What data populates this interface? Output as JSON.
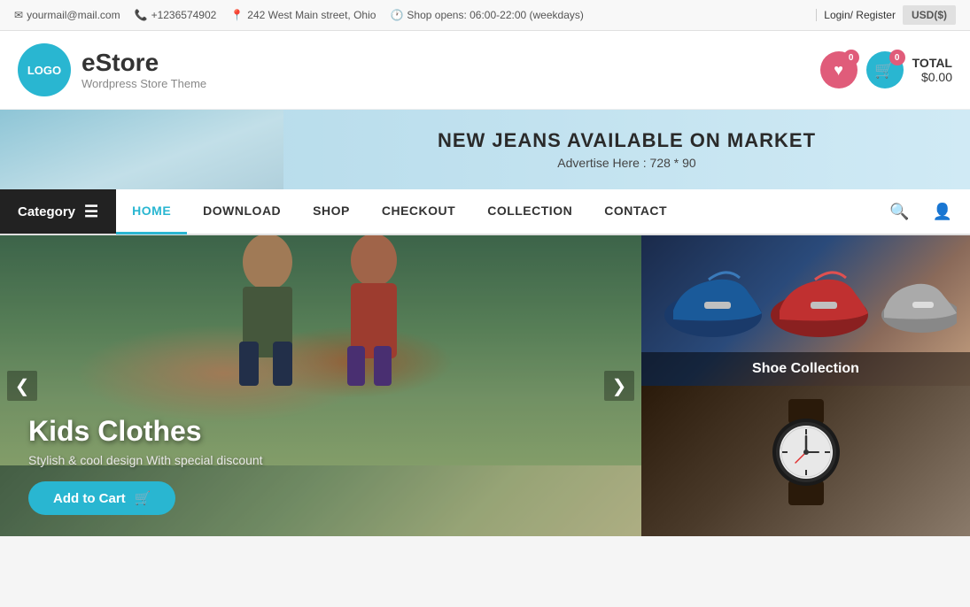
{
  "topbar": {
    "email_icon": "✉",
    "email": "yourmail@mail.com",
    "phone_icon": "📞",
    "phone": "+1236574902",
    "location_icon": "📍",
    "address": "242 West Main street, Ohio",
    "clock_icon": "🕐",
    "hours": "Shop opens: 06:00-22:00 (weekdays)",
    "login": "Login/ Register",
    "currency": "USD($)"
  },
  "header": {
    "logo_text": "LOGO",
    "store_name": "eStore",
    "tagline": "Wordpress Store Theme",
    "heart_count": "0",
    "cart_count": "0",
    "total_label": "TOTAL",
    "total_amount": "$0.00"
  },
  "banner": {
    "headline": "NEW JEANS AVAILABLE ON MARKET",
    "subtext": "Advertise Here : 728 * 90"
  },
  "nav": {
    "category_label": "Category",
    "links": [
      {
        "label": "HOME",
        "active": true
      },
      {
        "label": "DOWNLOAD",
        "active": false
      },
      {
        "label": "SHOP",
        "active": false
      },
      {
        "label": "CHECKOUT",
        "active": false
      },
      {
        "label": "COLLECTION",
        "active": false
      },
      {
        "label": "CONTACT",
        "active": false
      }
    ]
  },
  "slider": {
    "title": "Kids Clothes",
    "description": "Stylish & cool design With special discount",
    "button_label": "Add to Cart",
    "cart_icon": "🛒",
    "prev_arrow": "❮",
    "next_arrow": "❯"
  },
  "panels": [
    {
      "label": "Shoe Collection",
      "type": "shoe"
    },
    {
      "label": "",
      "type": "watch"
    }
  ],
  "icons": {
    "search": "🔍",
    "user": "👤",
    "hamburger": "☰"
  }
}
